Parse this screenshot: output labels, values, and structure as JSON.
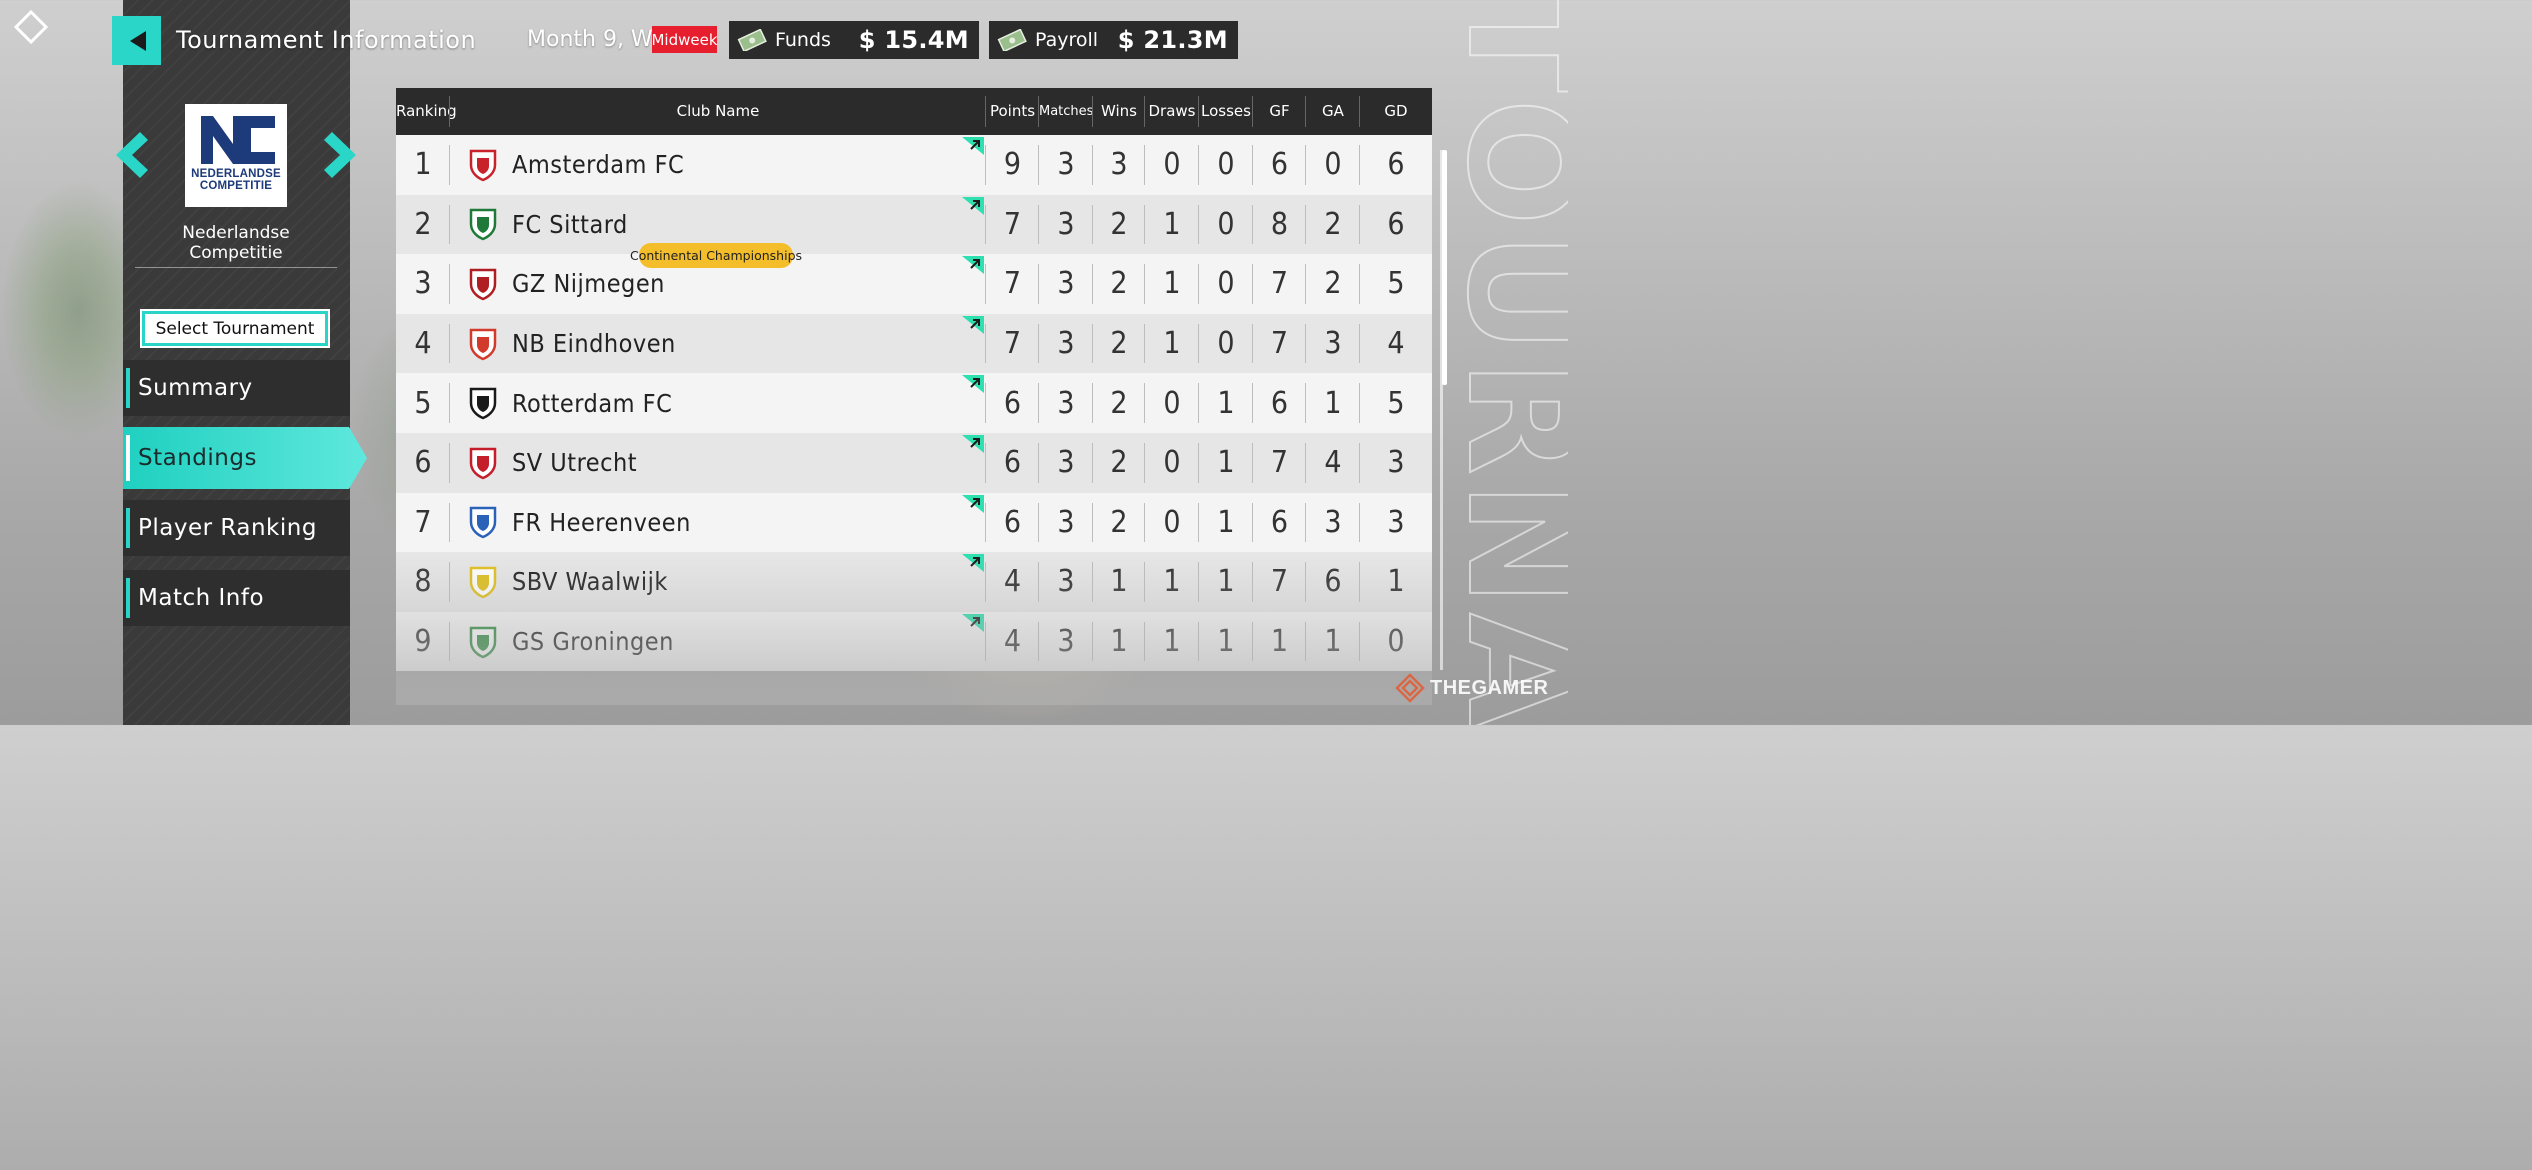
{
  "header": {
    "title": "Tournament Information",
    "month_label": "Month 9, W1",
    "midweek_badge": "Midweek",
    "funds_label": "Funds",
    "funds_value": "$ 15.4M",
    "payroll_label": "Payroll",
    "payroll_value": "$ 21.3M"
  },
  "tournament": {
    "logo_line1": "NEDERLANDSE",
    "logo_line2": "COMPETITIE",
    "name": "Nederlandse Competitie",
    "select_label": "Select Tournament"
  },
  "menu": {
    "items": [
      {
        "label": "Summary",
        "active": false
      },
      {
        "label": "Standings",
        "active": true
      },
      {
        "label": "Player Ranking",
        "active": false
      },
      {
        "label": "Match Info",
        "active": false
      }
    ]
  },
  "table": {
    "columns": [
      "Ranking",
      "Club Name",
      "Points",
      "Matches",
      "Wins",
      "Draws",
      "Losses",
      "GF",
      "GA",
      "GD"
    ],
    "qualification_label": "Continental Championships",
    "rows": [
      {
        "rank": "1",
        "club": "Amsterdam FC",
        "points": "9",
        "matches": "3",
        "wins": "3",
        "draws": "0",
        "losses": "0",
        "gf": "6",
        "ga": "0",
        "gd": "6",
        "crest_color": "#c8222a"
      },
      {
        "rank": "2",
        "club": "FC Sittard",
        "points": "7",
        "matches": "3",
        "wins": "2",
        "draws": "1",
        "losses": "0",
        "gf": "8",
        "ga": "2",
        "gd": "6",
        "crest_color": "#1f7a3a"
      },
      {
        "rank": "3",
        "club": "GZ Nijmegen",
        "points": "7",
        "matches": "3",
        "wins": "2",
        "draws": "1",
        "losses": "0",
        "gf": "7",
        "ga": "2",
        "gd": "5",
        "crest_color": "#b01e24"
      },
      {
        "rank": "4",
        "club": "NB Eindhoven",
        "points": "7",
        "matches": "3",
        "wins": "2",
        "draws": "1",
        "losses": "0",
        "gf": "7",
        "ga": "3",
        "gd": "4",
        "crest_color": "#d23b2c"
      },
      {
        "rank": "5",
        "club": "Rotterdam FC",
        "points": "6",
        "matches": "3",
        "wins": "2",
        "draws": "0",
        "losses": "1",
        "gf": "6",
        "ga": "1",
        "gd": "5",
        "crest_color": "#1a1a1a"
      },
      {
        "rank": "6",
        "club": "SV Utrecht",
        "points": "6",
        "matches": "3",
        "wins": "2",
        "draws": "0",
        "losses": "1",
        "gf": "7",
        "ga": "4",
        "gd": "3",
        "crest_color": "#c41e2a"
      },
      {
        "rank": "7",
        "club": "FR Heerenveen",
        "points": "6",
        "matches": "3",
        "wins": "2",
        "draws": "0",
        "losses": "1",
        "gf": "6",
        "ga": "3",
        "gd": "3",
        "crest_color": "#2a62b8"
      },
      {
        "rank": "8",
        "club": "SBV Waalwijk",
        "points": "4",
        "matches": "3",
        "wins": "1",
        "draws": "1",
        "losses": "1",
        "gf": "7",
        "ga": "6",
        "gd": "1",
        "crest_color": "#e0c020"
      },
      {
        "rank": "9",
        "club": "GS Groningen",
        "points": "4",
        "matches": "3",
        "wins": "1",
        "draws": "1",
        "losses": "1",
        "gf": "1",
        "ga": "1",
        "gd": "0",
        "crest_color": "#2e8a3e"
      }
    ]
  },
  "colors": {
    "accent": "#29d6c8",
    "panel": "#3a3a3a",
    "qualification": "#f0b62a",
    "midweek": "#e61e2d"
  },
  "watermark": "THEGAMER"
}
